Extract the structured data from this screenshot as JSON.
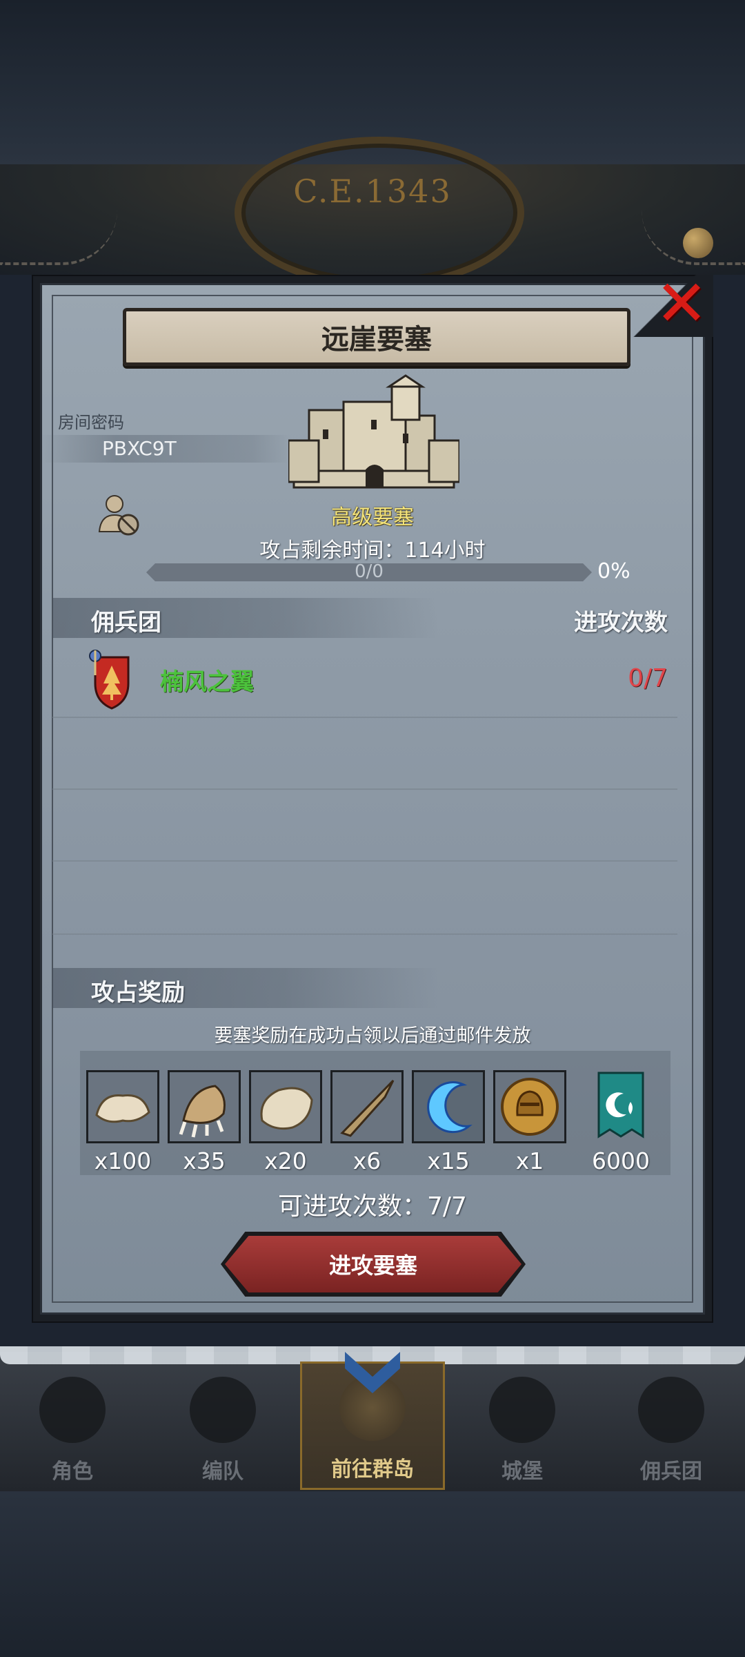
{
  "header": {
    "era": "C.E.1343"
  },
  "dialog": {
    "title": "远崖要塞",
    "close_icon": "close-x-icon",
    "room": {
      "label": "房间密码",
      "code": "PBXC9T"
    },
    "fortress": {
      "level_name": "高级要塞",
      "remaining_label": "攻占剩余时间：",
      "remaining_value": "114小时",
      "progress_text": "0/0",
      "progress_fraction": 0,
      "progress_percent": "0%"
    },
    "mercenary_section": {
      "title": "佣兵团",
      "count_header": "进攻次数",
      "rows": [
        {
          "name": "楠风之翼",
          "attacks": "0/7"
        }
      ]
    },
    "reward_section": {
      "title": "攻占奖励",
      "note": "要塞奖励在成功占领以后通过邮件发放",
      "items": [
        {
          "icon": "fur-pelt-icon",
          "qty": "x100"
        },
        {
          "icon": "beast-claw-icon",
          "qty": "x35"
        },
        {
          "icon": "hide-pelt-icon",
          "qty": "x20"
        },
        {
          "icon": "horn-icon",
          "qty": "x6"
        },
        {
          "icon": "crescent-moon-crystal-icon",
          "qty": "x15"
        },
        {
          "icon": "knight-helmet-coin-icon",
          "qty": "x1"
        },
        {
          "icon": "guild-banner-icon",
          "qty": "6000"
        }
      ]
    },
    "attacks_left": "可进攻次数：7/7",
    "attack_button": "进攻要塞"
  },
  "navbar": {
    "items": [
      {
        "label": "角色",
        "icon": "character-knight-icon",
        "active": false
      },
      {
        "label": "编队",
        "icon": "formation-helmet-icon",
        "active": false
      },
      {
        "label": "前往群岛",
        "icon": "islands-compass-icon",
        "active": true
      },
      {
        "label": "城堡",
        "icon": "castle-icon",
        "active": false
      },
      {
        "label": "佣兵团",
        "icon": "mercenary-icon",
        "active": false
      }
    ]
  },
  "colors": {
    "accent_red": "#d81c16",
    "merc_name_green": "#4cc23c",
    "attack_count_red": "#e0454a",
    "fortress_level_yellow": "#f3e37a"
  }
}
